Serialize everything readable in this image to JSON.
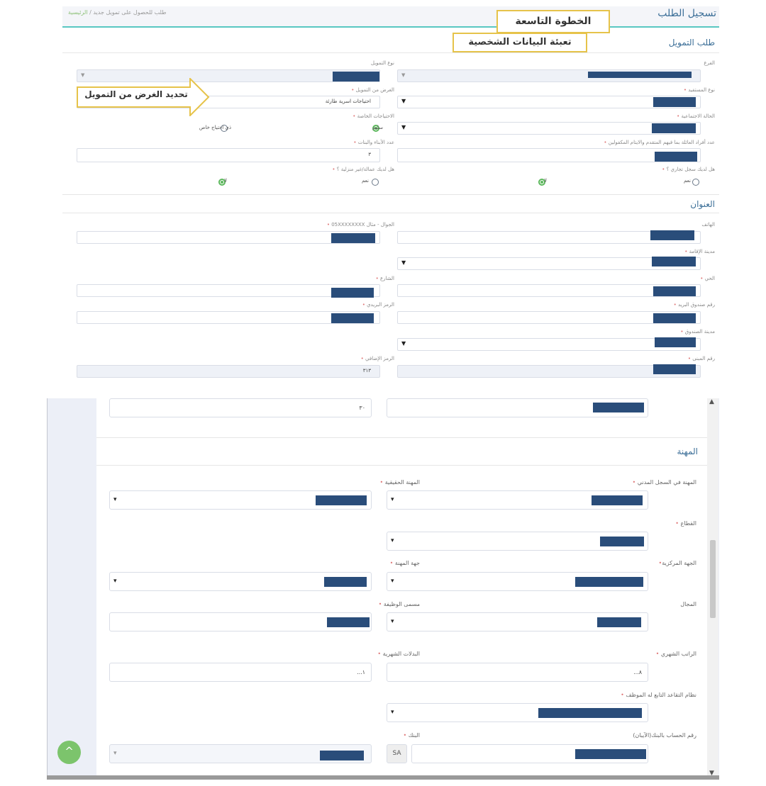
{
  "top": {
    "page_title": "تسجيل الطلب",
    "breadcrumb_home": "الرئيسية",
    "breadcrumb_sep": "/",
    "breadcrumb_current": "طلب للحصول على تمويل جديد",
    "section_finance": "طلب التمويل",
    "section_address": "العنوان",
    "fields": {
      "branch": "الفرع",
      "finance_type": "نوع التمويل",
      "beneficiary_type": "نوع المستفيد",
      "finance_purpose": "الغرض من التمويل",
      "finance_purpose_value": "احتياجات اسرية طارئة",
      "marital_status": "الحالة الاجتماعية",
      "special_needs": "الاحتياجات الخاصة",
      "special_needs_opt1": "سليم",
      "special_needs_opt2": "ذي احتياج خاص",
      "family_members": "عدد أفراد العائلة بما فيهم المتقدم والايتام المكفولين",
      "children_count": "عدد الأبناء والبنات",
      "children_value": "٣",
      "commercial_reg": "هل لديك سجل تجاري ؟",
      "domestic_workers": "هل لديك عمالة/غير منزلية ؟",
      "yes": "نعم",
      "no": "لا",
      "phone": "الهاتف",
      "mobile": "الجوال - مثال 05XXXXXXXX",
      "residence_city": "مدينة الإقامة",
      "district": "الحي",
      "street": "الشارع",
      "po_box": "رقم صندوق البريد",
      "postal_code": "الرمز البريدي",
      "box_city": "مدينة الصندوق",
      "building_no": "رقم المبنى",
      "additional_code": "الرمز الإضافي",
      "additional_code_value": "٣١٣"
    },
    "annotations": {
      "step": "الخطوة التاسعة",
      "personal": "تعبئة البيانات الشخصية",
      "purpose": "تحديد الغرض من التمويل"
    }
  },
  "bottom": {
    "top_value": "٣٠",
    "section_profession": "المهنة",
    "fields": {
      "civil_profession": "المهنة في السجل المدني",
      "actual_profession": "المهنة الحقيقية",
      "sector": "القطاع",
      "central_entity": "الجهة المركزية",
      "profession_entity": "جهة المهنة",
      "field": "المجال",
      "job_title": "مسمى الوظيفة",
      "monthly_salary": "الراتب الشهري",
      "monthly_salary_value": "٨...",
      "monthly_allowances": "البدلات الشهرية",
      "monthly_allowances_value": "١...",
      "retirement_system": "نظام التقاعد التابع له الموظف",
      "iban": "رقم الحساب بالبنك(الآيبان)",
      "iban_prefix": "SA",
      "bank": "البنك"
    },
    "fab_icon": "^"
  }
}
